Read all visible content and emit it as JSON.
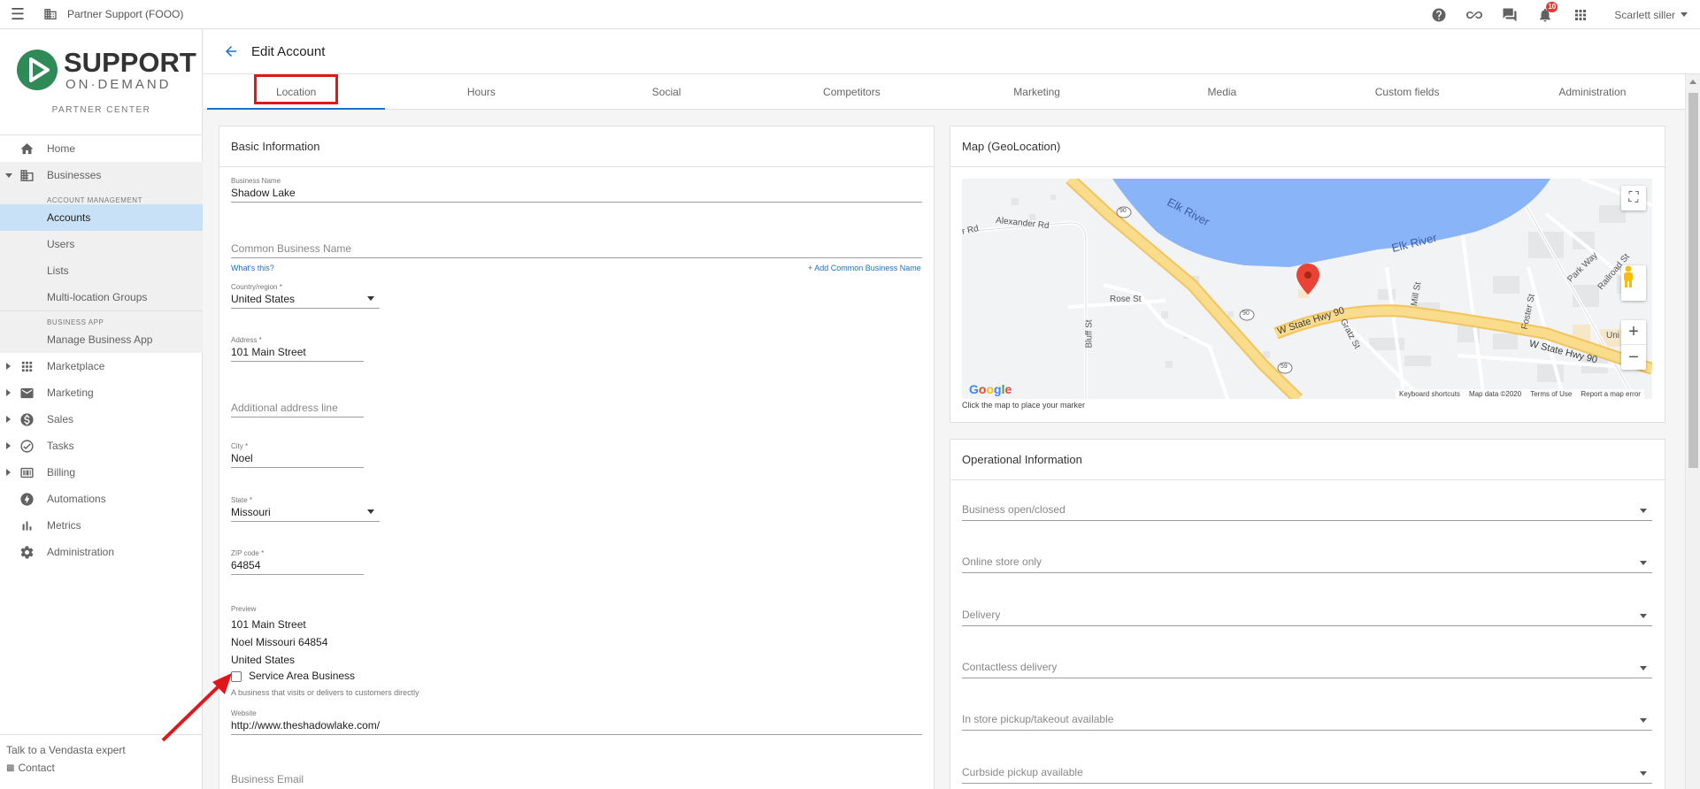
{
  "topbar": {
    "partner": "Partner Support (FOOO)",
    "notifications_count": "10",
    "user": "Scarlett siller"
  },
  "sidebar": {
    "logo_line1": "SUPPORT",
    "logo_line2": "ON·DEMAND",
    "partner_center": "PARTNER CENTER",
    "items": [
      {
        "label": "Home",
        "icon": "home-icon"
      },
      {
        "label": "Businesses",
        "icon": "business-icon"
      },
      {
        "label": "Marketplace",
        "icon": "grid-icon"
      },
      {
        "label": "Marketing",
        "icon": "mail-icon"
      },
      {
        "label": "Sales",
        "icon": "dollar-icon"
      },
      {
        "label": "Tasks",
        "icon": "check-circle-icon"
      },
      {
        "label": "Billing",
        "icon": "billing-icon"
      },
      {
        "label": "Automations",
        "icon": "bolt-icon"
      },
      {
        "label": "Metrics",
        "icon": "bar-chart-icon"
      },
      {
        "label": "Administration",
        "icon": "gear-icon"
      }
    ],
    "account_management_head": "ACCOUNT MANAGEMENT",
    "account_management": [
      "Accounts",
      "Users",
      "Lists",
      "Multi-location Groups"
    ],
    "business_app_head": "BUSINESS APP",
    "business_app": [
      "Manage Business App"
    ],
    "footer_expert": "Talk to a Vendasta expert",
    "footer_contact": "Contact"
  },
  "page": {
    "title": "Edit Account",
    "tabs": [
      "Location",
      "Hours",
      "Social",
      "Competitors",
      "Marketing",
      "Media",
      "Custom fields",
      "Administration"
    ]
  },
  "basic": {
    "title": "Basic Information",
    "business_name_label": "Business Name",
    "business_name": "Shadow Lake",
    "common_name_placeholder": "Common Business Name",
    "whats_this": "What's this?",
    "add_common": "+ Add Common Business Name",
    "country_label": "Country/region *",
    "country": "United States",
    "address_label": "Address *",
    "address": "101 Main Street",
    "address2_placeholder": "Additional address line",
    "city_label": "City *",
    "city": "Noel",
    "state_label": "State *",
    "state": "Missouri",
    "zip_label": "ZIP code *",
    "zip": "64854",
    "preview_label": "Preview",
    "preview_line1": "101 Main Street",
    "preview_line2": "Noel Missouri 64854",
    "preview_line3": "United States",
    "service_area_label": "Service Area Business",
    "service_area_help": "A business that visits or delivers to customers directly",
    "website_label": "Website",
    "website": "http://www.theshadowlake.com/",
    "email_placeholder": "Business Email"
  },
  "map": {
    "title": "Map (GeoLocation)",
    "labels": {
      "river1": "Elk River",
      "river2": "Elk River",
      "hwy1": "W State Hwy 90",
      "hwy2": "W State Hwy 90",
      "alexander": "Alexander Rd",
      "rd": "r Rd",
      "rose": "Rose St",
      "bluff": "Bluff St",
      "gratz": "Gratz St",
      "mill": "Mill St",
      "foster": "Foster St",
      "park": "Park Way",
      "railroad": "Railroad St",
      "uni": "Uni",
      "shield1": "90",
      "shield2": "90",
      "shield3": "59"
    },
    "google": [
      "G",
      "o",
      "o",
      "g",
      "l",
      "e"
    ],
    "footer_shortcuts": "Keyboard shortcuts",
    "footer_data": "Map data ©2020",
    "footer_terms": "Terms of Use",
    "footer_report": "Report a map error",
    "hint": "Click the map to place your marker"
  },
  "operational": {
    "title": "Operational Information",
    "fields": [
      "Business open/closed",
      "Online store only",
      "Delivery",
      "Contactless delivery",
      "In store pickup/takeout available",
      "Curbside pickup available"
    ]
  }
}
